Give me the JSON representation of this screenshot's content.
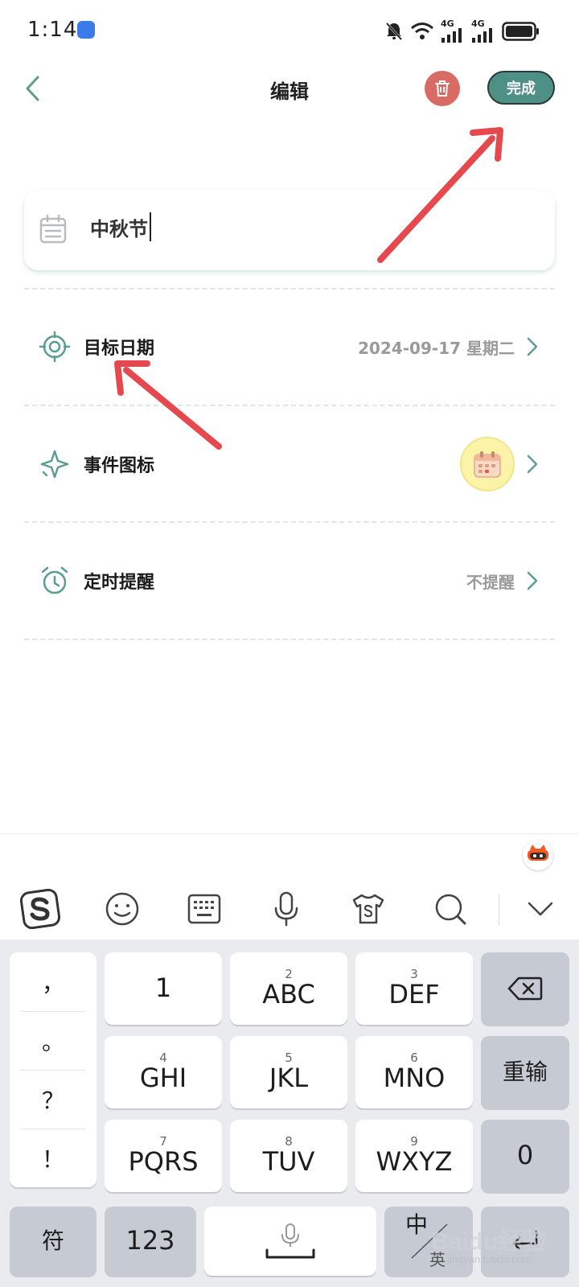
{
  "status_bar": {
    "time": "1:14",
    "net1": "4G",
    "net2": "4G"
  },
  "header": {
    "title": "编辑",
    "done_label": "完成"
  },
  "event": {
    "title_value": "中秋节"
  },
  "rows": {
    "target_date": {
      "label": "目标日期",
      "value": "2024-09-17 星期二"
    },
    "event_icon": {
      "label": "事件图标"
    },
    "reminder": {
      "label": "定时提醒",
      "value": "不提醒"
    }
  },
  "keyboard": {
    "punct": [
      "，",
      "。",
      "？",
      "！"
    ],
    "keys": [
      {
        "num": "",
        "main": "1"
      },
      {
        "num": "2",
        "main": "ABC"
      },
      {
        "num": "3",
        "main": "DEF"
      },
      {
        "num": "4",
        "main": "GHI"
      },
      {
        "num": "5",
        "main": "JKL"
      },
      {
        "num": "6",
        "main": "MNO"
      },
      {
        "num": "7",
        "main": "PQRS"
      },
      {
        "num": "8",
        "main": "TUV"
      },
      {
        "num": "9",
        "main": "WXYZ"
      }
    ],
    "reenter": "重输",
    "zero": "0",
    "symbol": "符",
    "numeric": "123",
    "lang_zh": "中",
    "lang_en": "英"
  },
  "watermark": {
    "logo": "Baidu经验",
    "sub": "jingyan.baidu.com"
  },
  "colors": {
    "accent": "#4e8f86",
    "delete": "#d86b63",
    "annotation": "#e5484d"
  }
}
